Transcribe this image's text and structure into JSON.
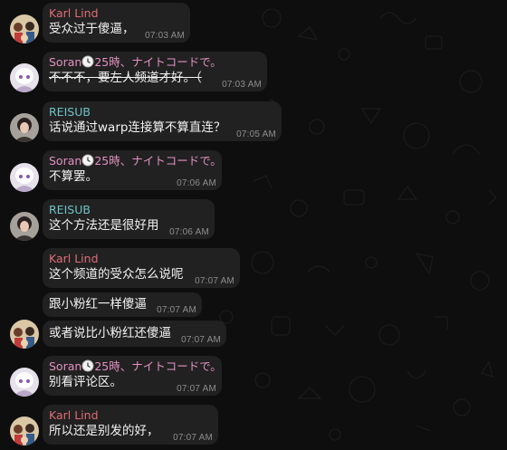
{
  "chat": {
    "colors": {
      "background": "#0e0e0e",
      "bubble": "#212121",
      "karl": "#e06c75",
      "soran": "#e491c2",
      "reisub": "#6fc3c9",
      "time": "#8d8d8d"
    },
    "messages": [
      {
        "sender": "Karl Lind",
        "text": "受众过于傻逼，",
        "time": "07:03 AM"
      },
      {
        "sender": "Soran",
        "status": "25時、ナイトコードで。",
        "text": "不不不，要左人频道才好。（",
        "time": "07:03 AM"
      },
      {
        "sender": "REISUB",
        "text": "话说通过warp连接算不算直连？",
        "time": "07:05 AM"
      },
      {
        "sender": "Soran",
        "status": "25時、ナイトコードで。",
        "text": "不算罢。",
        "time": "07:06 AM"
      },
      {
        "sender": "REISUB",
        "text": "这个方法还是很好用",
        "time": "07:06 AM"
      },
      {
        "sender": "Karl Lind",
        "text": "这个频道的受众怎么说呢",
        "time": "07:07 AM"
      },
      {
        "text": "跟小粉红一样傻逼",
        "time": "07:07 AM"
      },
      {
        "text": "或者说比小粉红还傻逼",
        "time": "07:07 AM"
      },
      {
        "sender": "Soran",
        "status": "25時、ナイトコードで。",
        "text": "别看评论区。",
        "time": "07:07 AM"
      },
      {
        "sender": "Karl Lind",
        "text": "所以还是别发的好，",
        "time": "07:07 AM"
      }
    ]
  }
}
